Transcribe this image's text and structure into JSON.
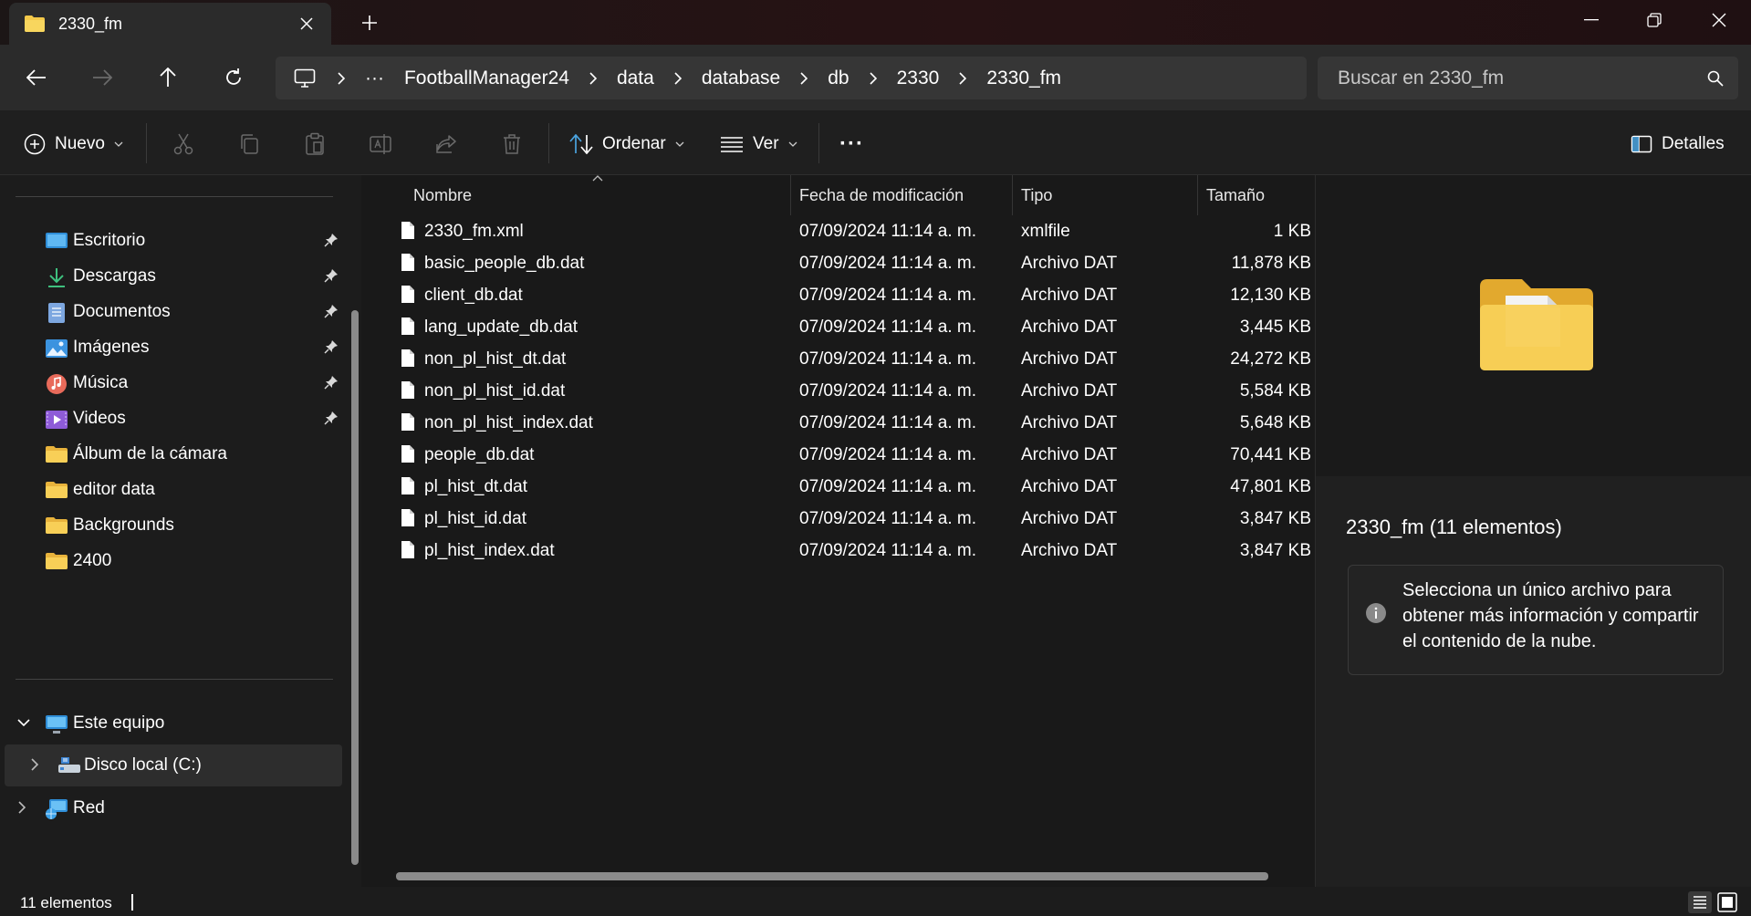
{
  "window": {
    "tab_title": "2330_fm",
    "new_tab_symbol": "+",
    "minimize_symbol": "—",
    "close_symbol": "✕"
  },
  "nav": {
    "breadcrumb_overflow": "···",
    "breadcrumbs": [
      "FootballManager24",
      "data",
      "database",
      "db",
      "2330",
      "2330_fm"
    ],
    "search_placeholder": "Buscar en 2330_fm"
  },
  "toolbar": {
    "new_label": "Nuevo",
    "sort_label": "Ordenar",
    "view_label": "Ver",
    "more_label": "···",
    "details_label": "Detalles"
  },
  "sidebar": {
    "quick_access": [
      {
        "label": "Escritorio",
        "icon": "desktop-icon",
        "pinned": true
      },
      {
        "label": "Descargas",
        "icon": "download-icon",
        "pinned": true
      },
      {
        "label": "Documentos",
        "icon": "documents-icon",
        "pinned": true
      },
      {
        "label": "Imágenes",
        "icon": "pictures-icon",
        "pinned": true
      },
      {
        "label": "Música",
        "icon": "music-icon",
        "pinned": true
      },
      {
        "label": "Videos",
        "icon": "videos-icon",
        "pinned": true
      },
      {
        "label": "Álbum de la cámara",
        "icon": "folder-icon",
        "pinned": false
      },
      {
        "label": "editor data",
        "icon": "folder-icon",
        "pinned": false
      },
      {
        "label": "Backgrounds",
        "icon": "folder-icon",
        "pinned": false
      },
      {
        "label": "2400",
        "icon": "folder-icon",
        "pinned": false
      }
    ],
    "this_pc": "Este equipo",
    "local_disk": "Disco local (C:)",
    "network": "Red"
  },
  "filelist": {
    "columns": {
      "name": "Nombre",
      "date": "Fecha de modificación",
      "type": "Tipo",
      "size": "Tamaño"
    },
    "files": [
      {
        "name": "2330_fm.xml",
        "date": "07/09/2024 11:14 a. m.",
        "type": "xmlfile",
        "size": "1 KB"
      },
      {
        "name": "basic_people_db.dat",
        "date": "07/09/2024 11:14 a. m.",
        "type": "Archivo DAT",
        "size": "11,878 KB"
      },
      {
        "name": "client_db.dat",
        "date": "07/09/2024 11:14 a. m.",
        "type": "Archivo DAT",
        "size": "12,130 KB"
      },
      {
        "name": "lang_update_db.dat",
        "date": "07/09/2024 11:14 a. m.",
        "type": "Archivo DAT",
        "size": "3,445 KB"
      },
      {
        "name": "non_pl_hist_dt.dat",
        "date": "07/09/2024 11:14 a. m.",
        "type": "Archivo DAT",
        "size": "24,272 KB"
      },
      {
        "name": "non_pl_hist_id.dat",
        "date": "07/09/2024 11:14 a. m.",
        "type": "Archivo DAT",
        "size": "5,584 KB"
      },
      {
        "name": "non_pl_hist_index.dat",
        "date": "07/09/2024 11:14 a. m.",
        "type": "Archivo DAT",
        "size": "5,648 KB"
      },
      {
        "name": "people_db.dat",
        "date": "07/09/2024 11:14 a. m.",
        "type": "Archivo DAT",
        "size": "70,441 KB"
      },
      {
        "name": "pl_hist_dt.dat",
        "date": "07/09/2024 11:14 a. m.",
        "type": "Archivo DAT",
        "size": "47,801 KB"
      },
      {
        "name": "pl_hist_id.dat",
        "date": "07/09/2024 11:14 a. m.",
        "type": "Archivo DAT",
        "size": "3,847 KB"
      },
      {
        "name": "pl_hist_index.dat",
        "date": "07/09/2024 11:14 a. m.",
        "type": "Archivo DAT",
        "size": "3,847 KB"
      }
    ]
  },
  "details": {
    "title": "2330_fm (11 elementos)",
    "info_text": "Selecciona un único archivo para obtener más información y compartir el contenido de la nube."
  },
  "status": {
    "item_count": "11 elementos"
  },
  "colors": {
    "folder_yellow": "#f4c94a",
    "background": "#191919",
    "accent_blue": "#4aa3df"
  }
}
